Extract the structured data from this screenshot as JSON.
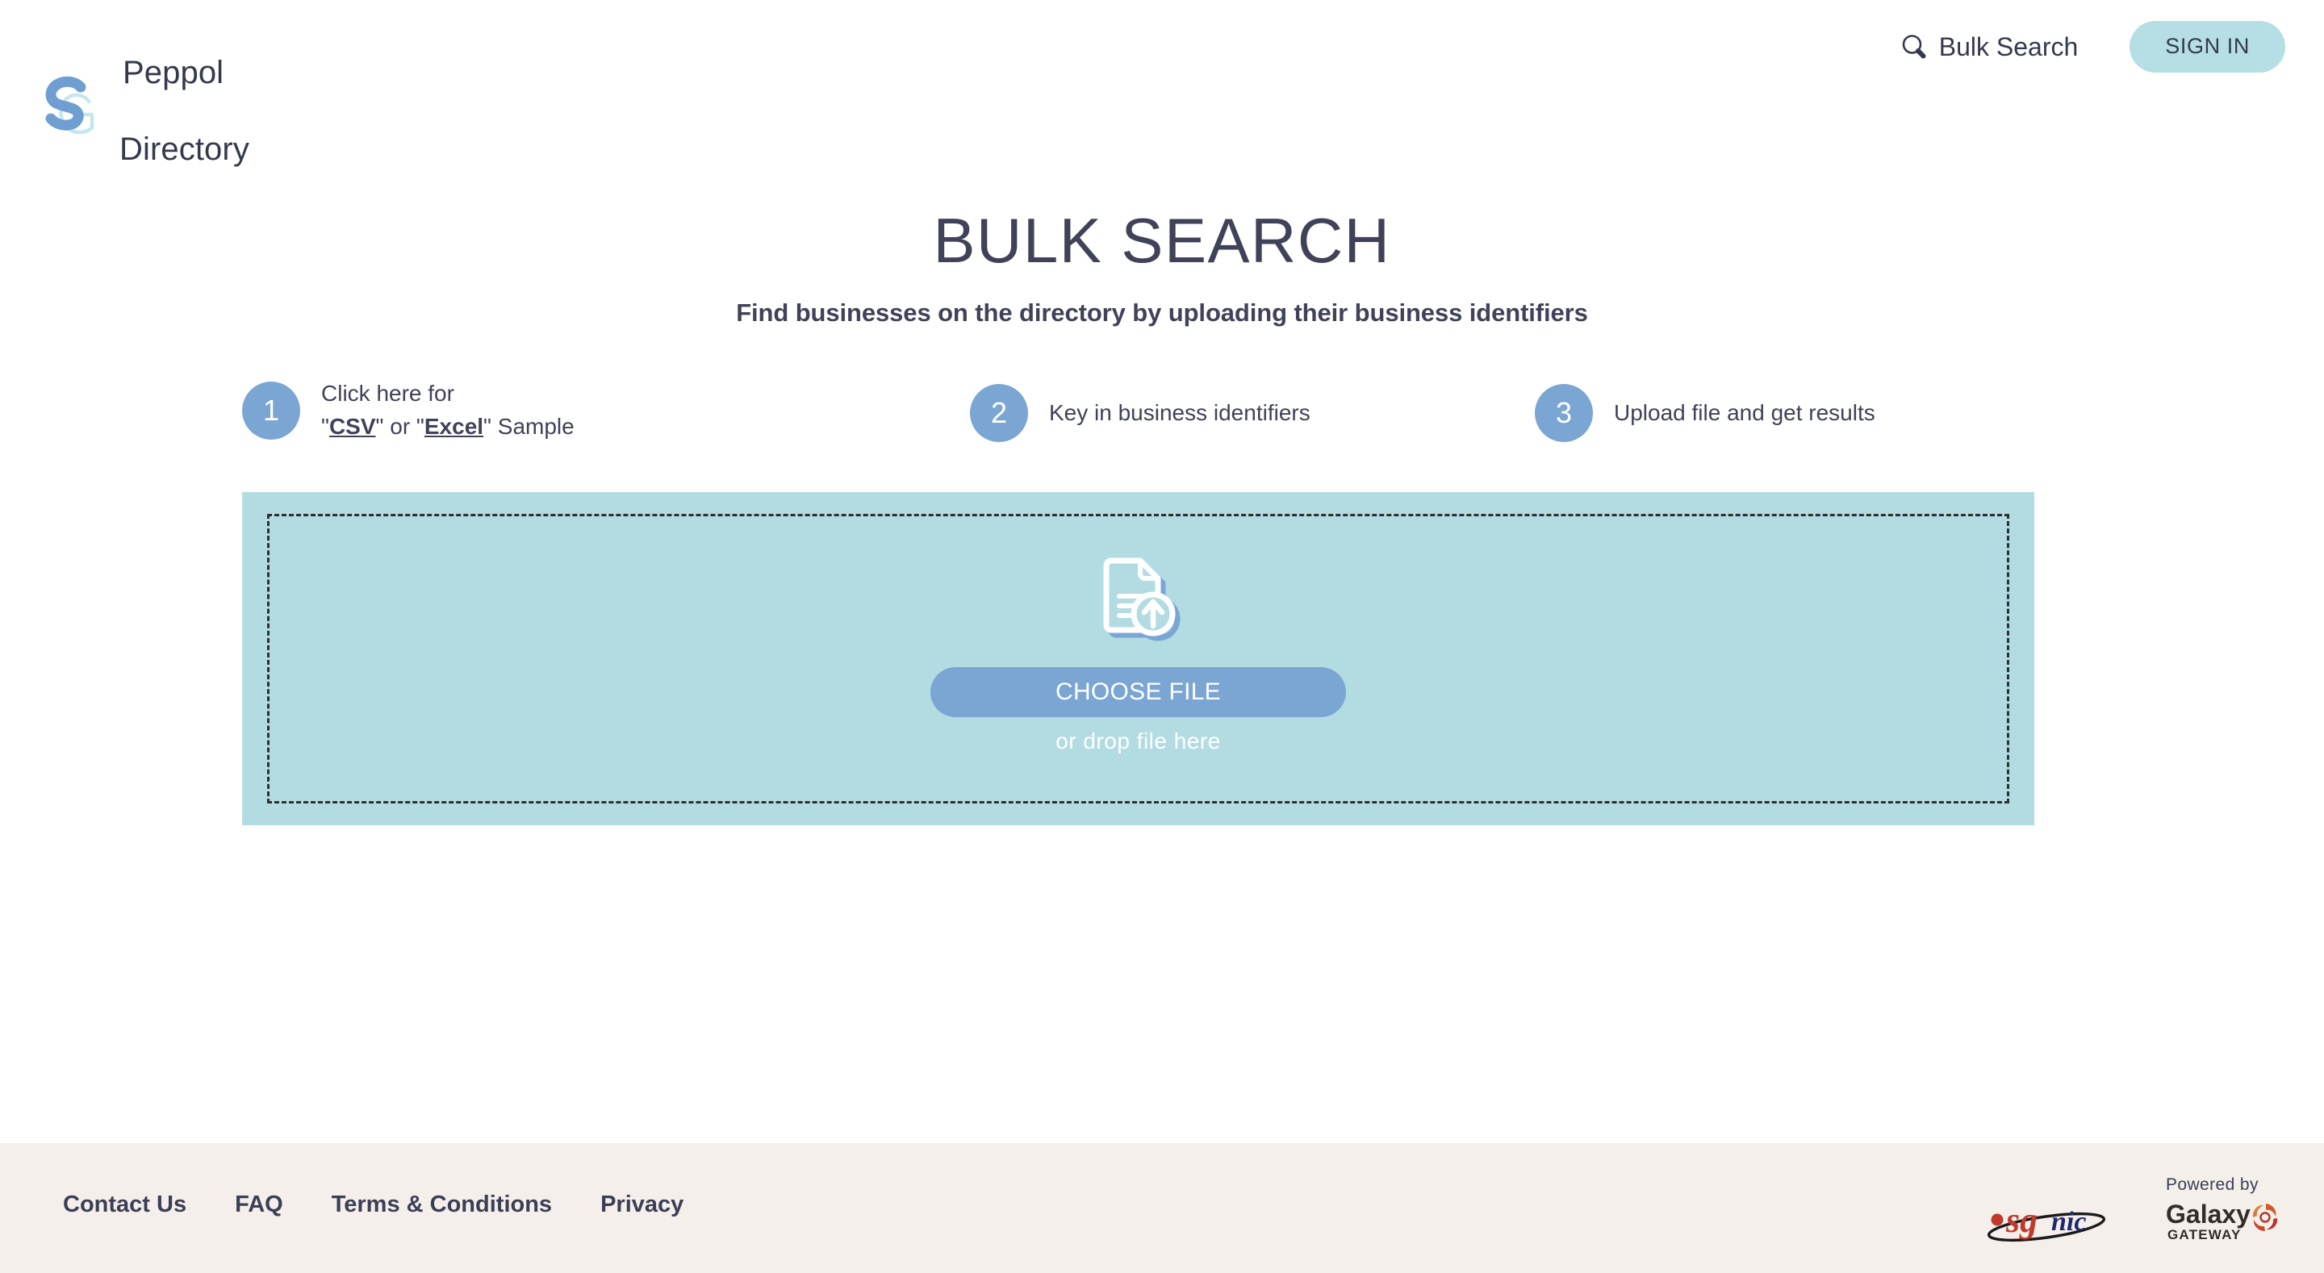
{
  "header": {
    "logo": {
      "mark_icon": "sg-monogram-icon",
      "line1": "Peppol",
      "line2": "Directory"
    },
    "bulk_search": {
      "icon": "search-icon",
      "label": "Bulk Search"
    },
    "sign_in_label": "SIGN IN"
  },
  "main": {
    "title": "BULK SEARCH",
    "subtitle": "Find businesses on the directory by uploading their business identifiers",
    "steps": [
      {
        "number": "1",
        "line1": "Click here for",
        "line2_prefix": "\"",
        "link1": "CSV",
        "line2_mid": "\" or \"",
        "link2": "Excel",
        "line2_suffix": "\" Sample"
      },
      {
        "number": "2",
        "line1": "Key in business identifiers"
      },
      {
        "number": "3",
        "line1": "Upload file and get results"
      }
    ],
    "dropzone": {
      "icon": "file-upload-icon",
      "choose_file_label": "CHOOSE FILE",
      "drop_hint": "or drop file here"
    }
  },
  "footer": {
    "links": [
      {
        "label": "Contact Us"
      },
      {
        "label": "FAQ"
      },
      {
        "label": "Terms & Conditions"
      },
      {
        "label": "Privacy"
      }
    ],
    "sgnic_logo_icon": "sgnic-logo-icon",
    "powered_by_label": "Powered by",
    "galaxy_logo_icon": "galaxy-gateway-logo-icon",
    "galaxy_name": "Galaxy",
    "galaxy_sub": "GATEWAY"
  },
  "colors": {
    "teal_panel": "#b2dce2",
    "sign_in_bg": "#b5dfe4",
    "accent_blue": "#7ba6d3",
    "text_dark": "#3f4258",
    "footer_bg": "#f4efeb",
    "logo_blue": "#6f9ed0",
    "logo_light": "#bfe3ea"
  }
}
